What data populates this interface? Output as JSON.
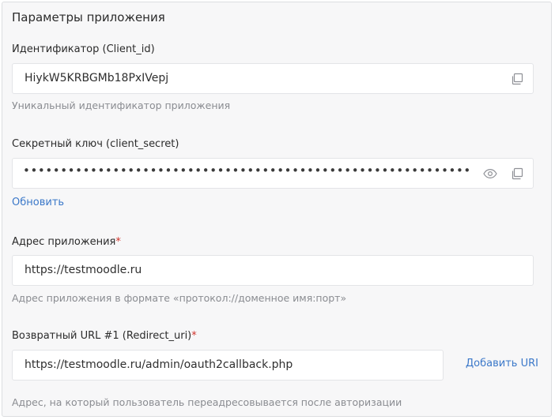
{
  "section": {
    "title": "Параметры приложения"
  },
  "client_id": {
    "label": "Идентификатор (Client_id)",
    "value": "HiykW5KRBGMb18PxIVepj",
    "hint": "Уникальный идентификатор приложения",
    "copy_icon": "copy-icon"
  },
  "client_secret": {
    "label": "Секретный ключ (client_secret)",
    "value": "•••••••••••••••••••••••••••••••••••••••••••••••••••••••••••••••••••",
    "refresh_link": "Обновить",
    "show_icon": "eye-icon",
    "copy_icon": "copy-icon"
  },
  "app_address": {
    "label": "Адрес приложения",
    "required_mark": "*",
    "value": "https://testmoodle.ru",
    "hint": "Адрес приложения в формате «протокол://доменное имя:порт»"
  },
  "redirect_uri": {
    "label": "Возвратный URL #1 (Redirect_uri)",
    "required_mark": "*",
    "value": "https://testmoodle.ru/admin/oauth2callback.php",
    "add_link": "Добавить URI",
    "hint": "Адрес, на который пользователь переадресовывается после авторизации"
  }
}
